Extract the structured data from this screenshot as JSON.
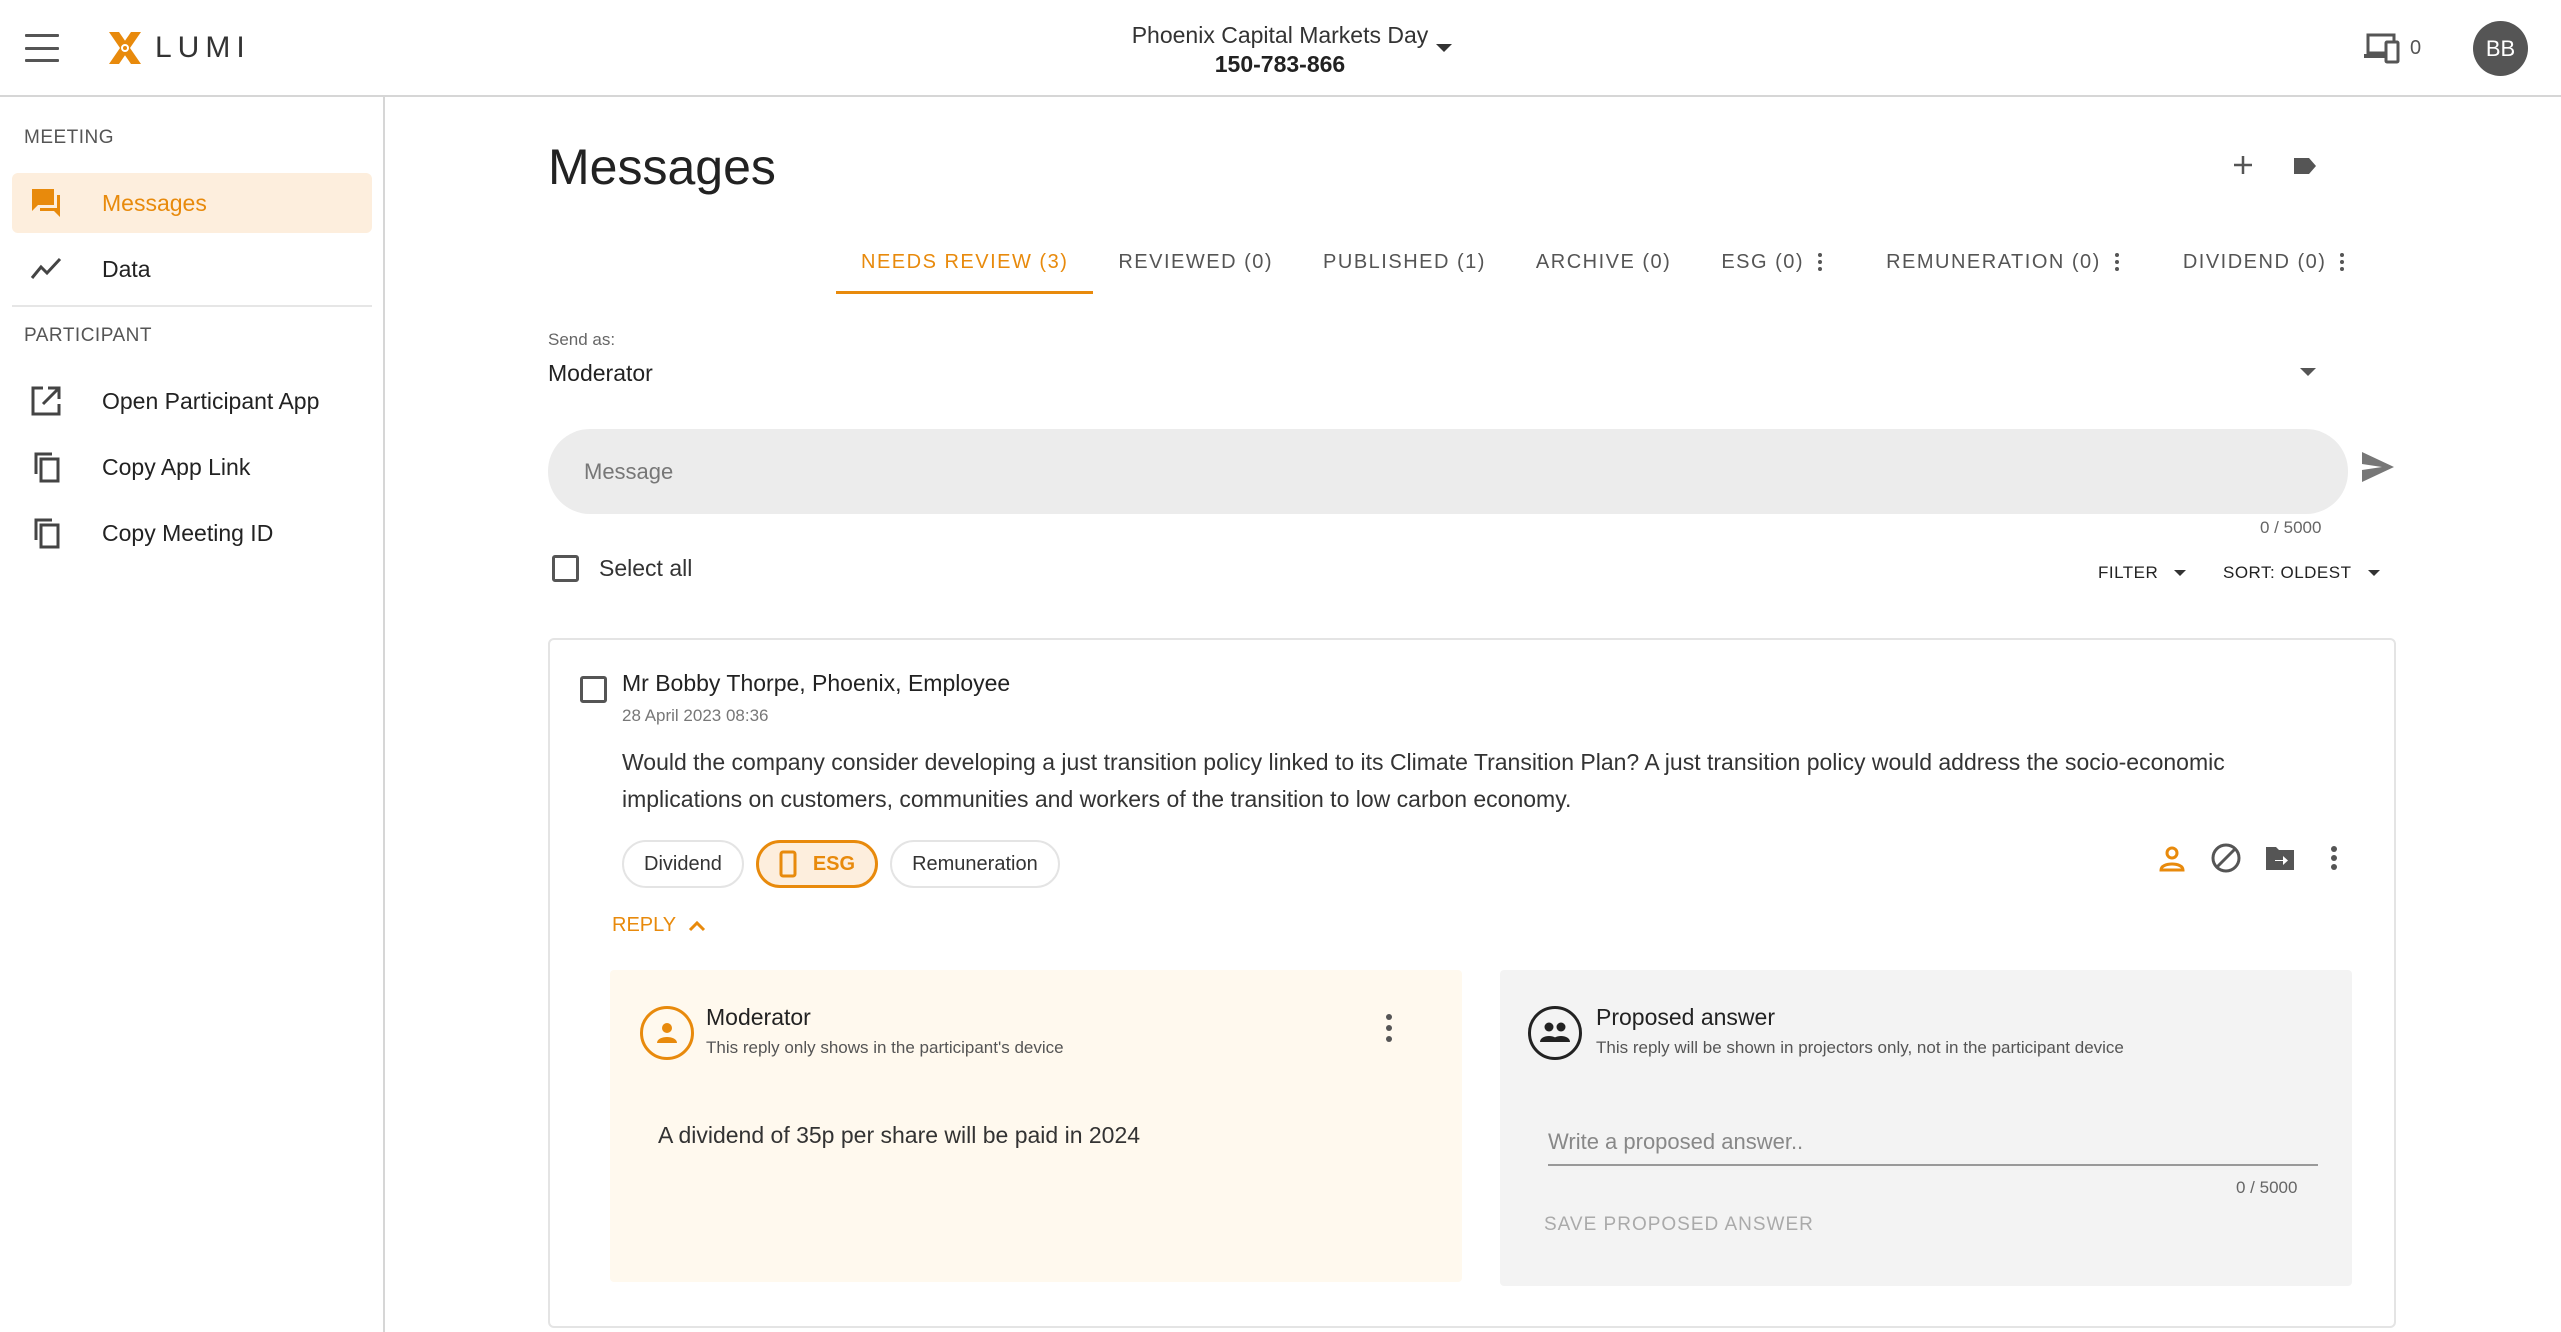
{
  "header": {
    "logo_text": "LUMI",
    "meeting_name": "Phoenix Capital Markets Day",
    "meeting_id": "150-783-866",
    "devices_count": "0",
    "user_initials": "BB"
  },
  "sidebar": {
    "sections": [
      {
        "title": "MEETING",
        "items": [
          {
            "label": "Messages",
            "icon": "chat-icon",
            "active": true
          },
          {
            "label": "Data",
            "icon": "trend-line-icon",
            "active": false
          }
        ]
      },
      {
        "title": "PARTICIPANT",
        "items": [
          {
            "label": "Open Participant App",
            "icon": "open-external-icon",
            "active": false
          },
          {
            "label": "Copy App Link",
            "icon": "copy-icon",
            "active": false
          },
          {
            "label": "Copy Meeting ID",
            "icon": "copy-icon",
            "active": false
          }
        ]
      }
    ]
  },
  "main": {
    "title": "Messages",
    "top_actions": [
      "add-icon",
      "label-tag-icon"
    ],
    "tabs": [
      {
        "label": "NEEDS REVIEW (3)",
        "active": true,
        "menu": false
      },
      {
        "label": "REVIEWED (0)",
        "active": false,
        "menu": false
      },
      {
        "label": "PUBLISHED (1)",
        "active": false,
        "menu": false
      },
      {
        "label": "ARCHIVE (0)",
        "active": false,
        "menu": false
      },
      {
        "label": "ESG (0)",
        "active": false,
        "menu": true
      },
      {
        "label": "REMUNERATION (0)",
        "active": false,
        "menu": true
      },
      {
        "label": "DIVIDEND (0)",
        "active": false,
        "menu": true
      }
    ],
    "send_as": {
      "label": "Send as:",
      "value": "Moderator"
    },
    "composer": {
      "placeholder": "Message",
      "count": "0 / 5000"
    },
    "select_all_label": "Select all",
    "filter_label": "FILTER",
    "sort_label": "SORT: OLDEST"
  },
  "message": {
    "author": "Mr Bobby Thorpe, Phoenix, Employee",
    "timestamp": "28 April 2023 08:36",
    "body": "Would the company consider developing a just transition policy linked to its Climate Transition Plan? A just transition policy would address the socio-economic implications on customers, communities and workers of the transition to low carbon economy.",
    "tags": [
      {
        "label": "Dividend",
        "selected": false
      },
      {
        "label": "ESG",
        "selected": true
      },
      {
        "label": "Remuneration",
        "selected": false
      }
    ],
    "actions": [
      "person-icon",
      "block-icon",
      "move-to-folder-icon",
      "more-vert-icon"
    ],
    "reply_label": "REPLY",
    "moderator_reply": {
      "title": "Moderator",
      "subtitle": "This reply only shows in the participant's device",
      "answer": "A dividend of 35p per share will be paid in 2024"
    },
    "proposed_answer": {
      "title": "Proposed answer",
      "subtitle": "This reply will be shown in projectors only, not in the participant device",
      "placeholder": "Write a proposed answer..",
      "count": "0 / 5000",
      "save_label": "SAVE PROPOSED ANSWER"
    }
  },
  "colors": {
    "accent": "#e88a0c",
    "accent_light": "#fdeedd",
    "moderator_panel": "#fff9ee",
    "proposed_panel": "#f3f3f3"
  }
}
